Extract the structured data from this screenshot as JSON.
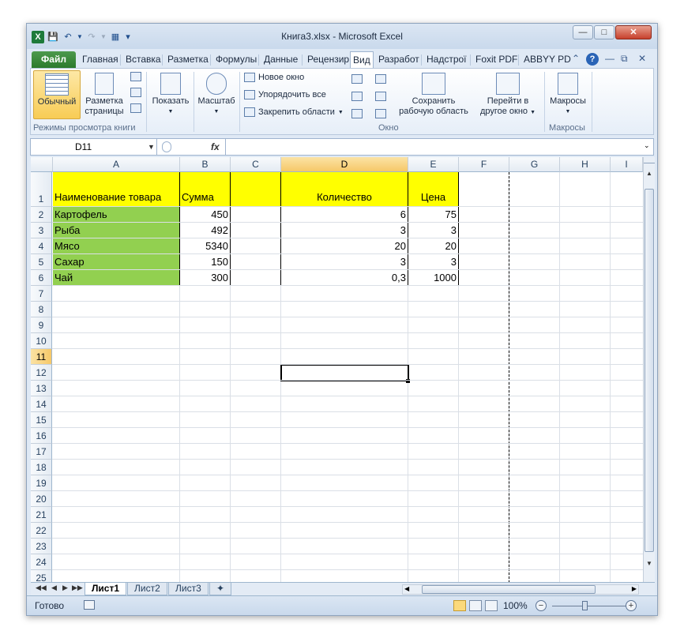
{
  "window": {
    "title": "Книга3.xlsx - Microsoft Excel"
  },
  "tabs": {
    "file": "Файл",
    "home": "Главная",
    "insert": "Вставка",
    "layout": "Разметка",
    "formulas": "Формулы",
    "data": "Данные",
    "review": "Рецензир",
    "view": "Вид",
    "developer": "Разработ",
    "addins": "Надстрої",
    "foxit": "Foxit PDF",
    "abbyy": "ABBYY PD"
  },
  "ribbon": {
    "normal": "Обычный",
    "page_layout_1": "Разметка",
    "page_layout_2": "страницы",
    "group_views": "Режимы просмотра книги",
    "show": "Показать",
    "zoom": "Масштаб",
    "new_window": "Новое окно",
    "arrange_all": "Упорядочить все",
    "freeze_panes": "Закрепить области",
    "save_workspace_1": "Сохранить",
    "save_workspace_2": "рабочую область",
    "switch_windows_1": "Перейти в",
    "switch_windows_2": "другое окно",
    "group_window": "Окно",
    "macros": "Макросы",
    "group_macros": "Макросы"
  },
  "formula_bar": {
    "name_box": "D11",
    "fx": "fx",
    "content": ""
  },
  "grid": {
    "columns": [
      "A",
      "B",
      "C",
      "D",
      "E",
      "F",
      "G",
      "H",
      "I"
    ],
    "rows": [
      "1",
      "2",
      "3",
      "4",
      "5",
      "6",
      "7",
      "8",
      "9",
      "10",
      "11",
      "12",
      "13",
      "14",
      "15",
      "16",
      "17",
      "18",
      "19",
      "20",
      "21",
      "22",
      "23",
      "24",
      "25"
    ],
    "selected_cell": "D11",
    "header_row": {
      "name": "Наименование товара",
      "sum": "Сумма",
      "qty": "Количество",
      "price": "Цена"
    },
    "data_rows": [
      {
        "name": "Картофель",
        "sum": "450",
        "qty": "6",
        "price": "75"
      },
      {
        "name": "Рыба",
        "sum": "492",
        "qty": "3",
        "price": "3"
      },
      {
        "name": "Мясо",
        "sum": "5340",
        "qty": "20",
        "price": "20"
      },
      {
        "name": "Сахар",
        "sum": "150",
        "qty": "3",
        "price": "3"
      },
      {
        "name": "Чай",
        "sum": "300",
        "qty": "0,3",
        "price": "1000"
      }
    ]
  },
  "sheets": [
    "Лист1",
    "Лист2",
    "Лист3"
  ],
  "active_sheet": "Лист1",
  "status": {
    "text": "Готово",
    "zoom": "100%"
  },
  "colors": {
    "yellow": "#ffff00",
    "green": "#92d050",
    "file_tab": "#2c7a2c"
  }
}
